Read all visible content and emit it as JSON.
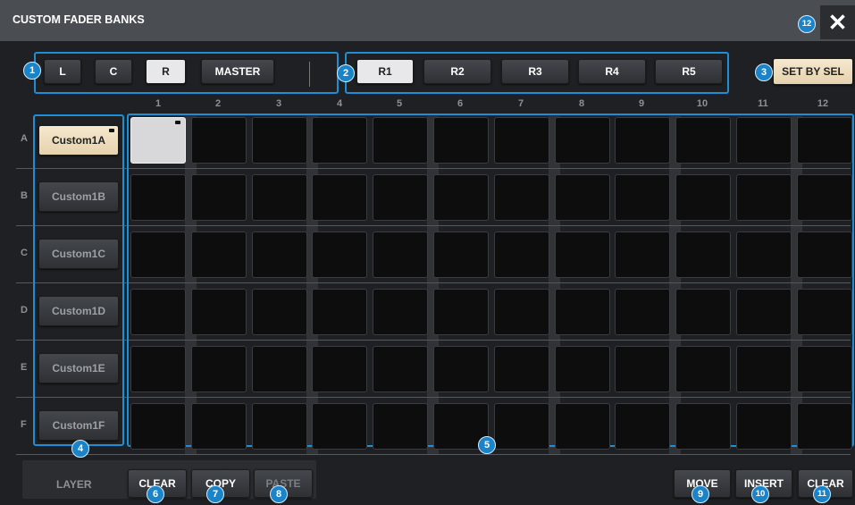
{
  "window": {
    "title": "CUSTOM FADER BANKS",
    "close_glyph": "✕"
  },
  "layer_buttons": [
    {
      "label": "L",
      "state": "off"
    },
    {
      "label": "C",
      "state": "off"
    },
    {
      "label": "R",
      "state": "on"
    },
    {
      "label": "MASTER",
      "state": "off"
    }
  ],
  "bank_buttons": [
    {
      "label": "R1",
      "state": "on"
    },
    {
      "label": "R2",
      "state": "off"
    },
    {
      "label": "R3",
      "state": "off"
    },
    {
      "label": "R4",
      "state": "off"
    },
    {
      "label": "R5",
      "state": "off"
    }
  ],
  "set_by_sel_label": "SET BY SEL",
  "columns": [
    "1",
    "2",
    "3",
    "4",
    "5",
    "6",
    "7",
    "8",
    "9",
    "10",
    "11",
    "12"
  ],
  "rows": [
    {
      "letter": "A",
      "bank_label": "Custom1A",
      "selected": true
    },
    {
      "letter": "B",
      "bank_label": "Custom1B",
      "selected": false
    },
    {
      "letter": "C",
      "bank_label": "Custom1C",
      "selected": false
    },
    {
      "letter": "D",
      "bank_label": "Custom1D",
      "selected": false
    },
    {
      "letter": "E",
      "bank_label": "Custom1E",
      "selected": false
    },
    {
      "letter": "F",
      "bank_label": "Custom1F",
      "selected": false
    }
  ],
  "active_cell": {
    "row": "A",
    "column": "1"
  },
  "bottom": {
    "layer_label": "LAYER",
    "clear_label": "CLEAR",
    "copy_label": "COPY",
    "paste_label": "PASTE",
    "move_label": "MOVE",
    "insert_label": "INSERT",
    "clear2_label": "CLEAR"
  },
  "callouts": [
    "1",
    "2",
    "3",
    "4",
    "5",
    "6",
    "7",
    "8",
    "9",
    "10",
    "11",
    "12"
  ],
  "colors": {
    "highlight": "#1e8fd6",
    "badge": "#1b84c9",
    "selected_bank": "#f0e2c6",
    "background": "#1f2023"
  }
}
